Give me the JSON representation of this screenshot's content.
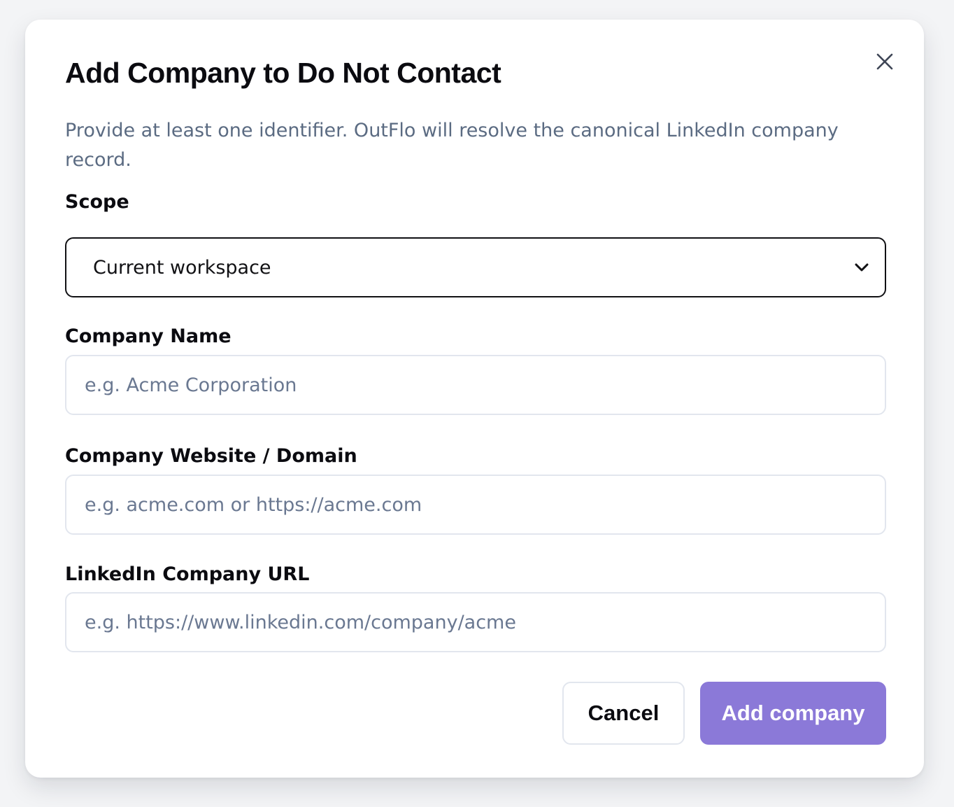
{
  "dialog": {
    "title": "Add Company to Do Not Contact",
    "description": "Provide at least one identifier. OutFlo will resolve the canonical LinkedIn company record.",
    "close_icon": "close-icon"
  },
  "scope": {
    "label": "Scope",
    "selected": "Current workspace",
    "icon": "chevron-down-icon"
  },
  "company_name": {
    "label": "Company Name",
    "value": "",
    "placeholder": "e.g. Acme Corporation"
  },
  "company_website": {
    "label": "Company Website / Domain",
    "value": "",
    "placeholder": "e.g. acme.com or https://acme.com"
  },
  "linkedin_url": {
    "label": "LinkedIn Company URL",
    "value": "",
    "placeholder": "e.g. https://www.linkedin.com/company/acme"
  },
  "actions": {
    "cancel_label": "Cancel",
    "submit_label": "Add company"
  },
  "colors": {
    "primary_button": "#8b79d8",
    "description_text": "#5b6b82",
    "placeholder_text": "#6a7891",
    "input_border": "#e2e6ee"
  }
}
